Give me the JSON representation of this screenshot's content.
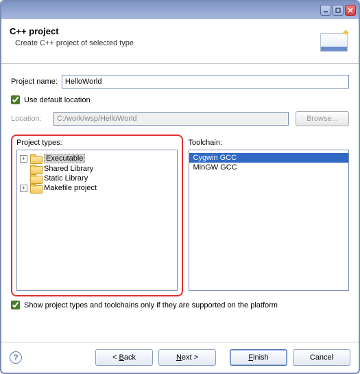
{
  "banner": {
    "title": "C++ project",
    "subtitle": "Create C++ project of selected type"
  },
  "project_name": {
    "label": "Project name:",
    "value": "HelloWorld"
  },
  "use_default_location": {
    "label": "Use default location",
    "checked": true
  },
  "location": {
    "label": "Location:",
    "value": "C:/work/wsp/HelloWorld",
    "browse": "Browse..."
  },
  "project_types": {
    "label": "Project types:",
    "items": [
      {
        "label": "Executable",
        "expandable": true,
        "selected": true
      },
      {
        "label": "Shared Library",
        "expandable": false,
        "selected": false
      },
      {
        "label": "Static Library",
        "expandable": false,
        "selected": false
      },
      {
        "label": "Makefile project",
        "expandable": true,
        "selected": false
      }
    ]
  },
  "toolchain": {
    "label": "Toolchain:",
    "items": [
      {
        "label": "Cygwin GCC",
        "selected": true
      },
      {
        "label": "MinGW GCC",
        "selected": false
      }
    ]
  },
  "show_supported": {
    "label": "Show project types and toolchains only if they are supported on the platform",
    "checked": true
  },
  "buttons": {
    "back": "< Back",
    "next": "Next >",
    "finish": "Finish",
    "cancel": "Cancel"
  }
}
